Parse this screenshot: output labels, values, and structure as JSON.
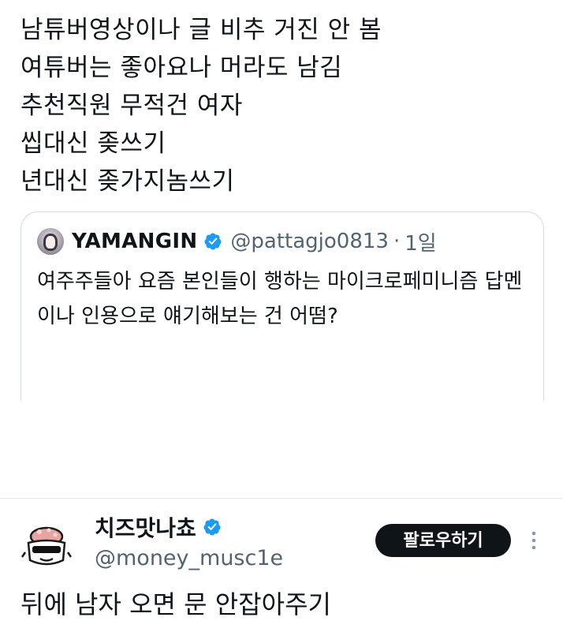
{
  "tweet": {
    "lines": [
      "남튜버영상이나 글 비추 거진 안 봄",
      "여튜버는 좋아요나 머라도 남김",
      "추천직원 무적건 여자",
      "씹대신 좆쓰기",
      "년대신 좆가지놈쓰기"
    ]
  },
  "quote": {
    "display_name": "YAMANGIN",
    "handle": "@pattagjo0813",
    "separator": "·",
    "date": "1일",
    "text": "여주주들아 요즘 본인들이 행하는 마이크로페미니즘 답멘이나 인용으로 얘기해보는 건 어떰?"
  },
  "reply": {
    "display_name": "치즈맛나쵸",
    "handle": "@money_musc1e",
    "follow_label": "팔로우하기",
    "text": "뒤에 남자 오면 문 안잡아주기"
  },
  "colors": {
    "text": "#0f1419",
    "secondary": "#536471",
    "verified": "#1d9bf0",
    "button_bg": "#0f1419",
    "border": "#d6dbdf"
  },
  "icons": {
    "verified": "verified-badge-icon",
    "more": "more-options-icon"
  }
}
